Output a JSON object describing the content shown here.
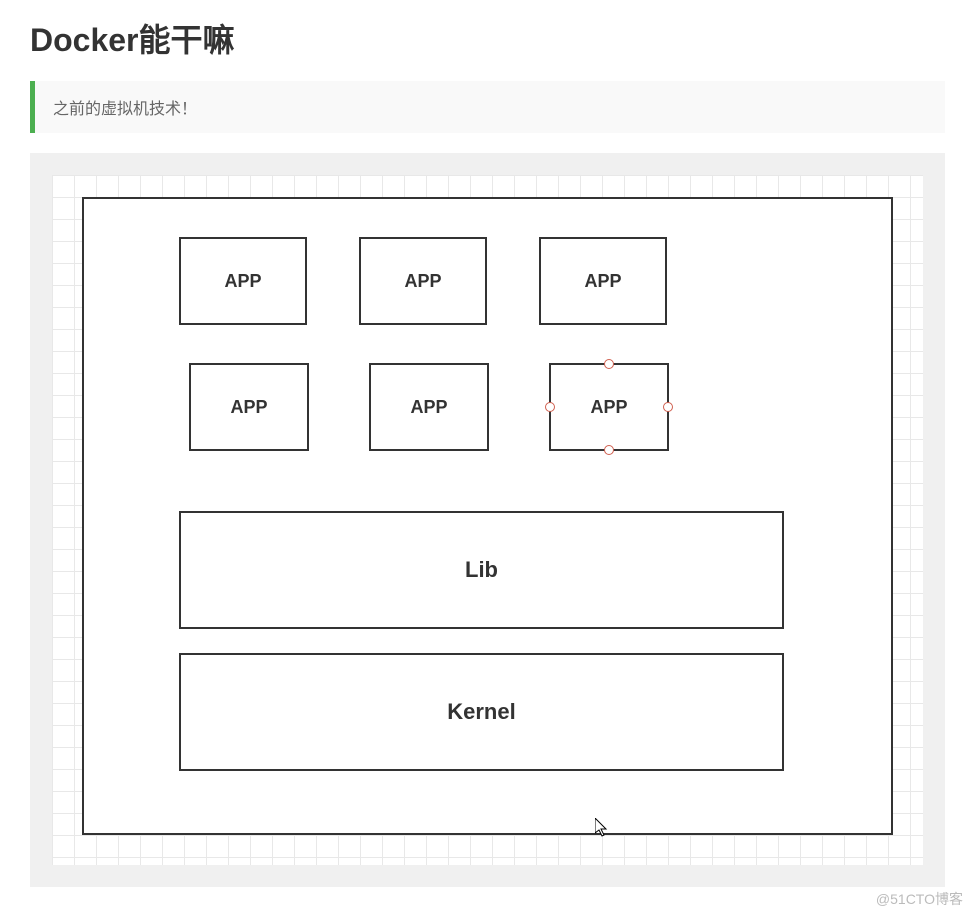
{
  "heading": "Docker能干嘛",
  "quote": "之前的虚拟机技术！",
  "diagram": {
    "apps_row1": [
      "APP",
      "APP",
      "APP"
    ],
    "apps_row2": [
      "APP",
      "APP",
      "APP"
    ],
    "lib_label": "Lib",
    "kernel_label": "Kernel"
  },
  "watermark": "@51CTO博客"
}
